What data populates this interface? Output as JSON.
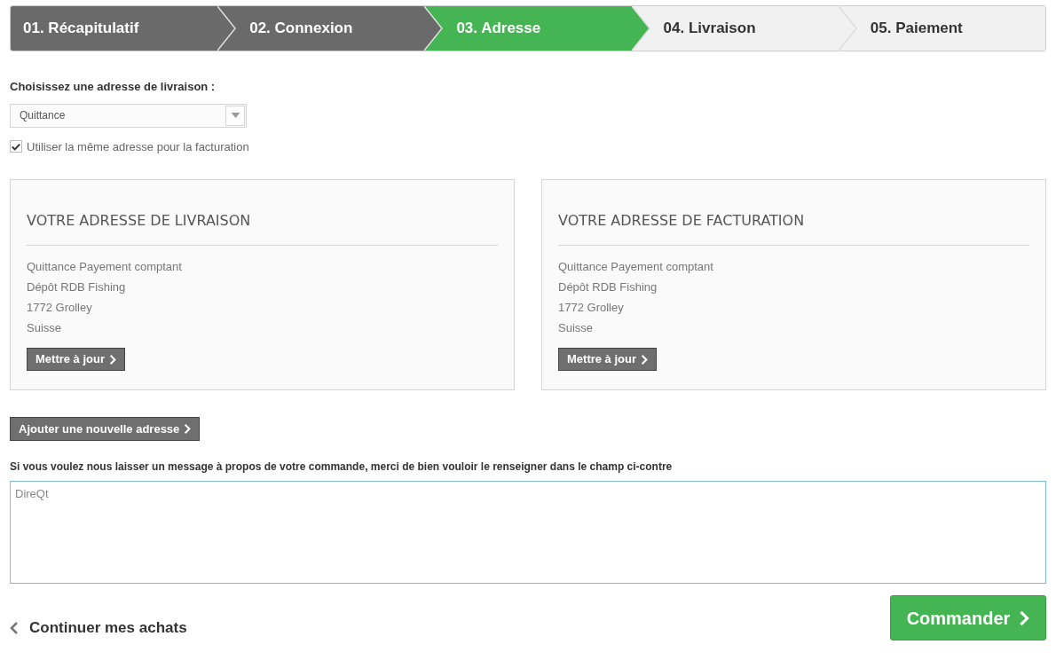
{
  "steps": [
    {
      "label": "01. Récapitulatif",
      "selected": false
    },
    {
      "label": "02. Connexion",
      "selected": false
    },
    {
      "label": "03. Adresse",
      "selected": true
    },
    {
      "label": "04. Livraison",
      "selected": false
    },
    {
      "label": "05. Paiement",
      "selected": false
    }
  ],
  "address_select": {
    "label": "Choisissez une adresse de livraison :",
    "value": "Quittance"
  },
  "same_billing": {
    "label": "Utiliser la même adresse pour la facturation",
    "checked": true
  },
  "address_cards": [
    {
      "title": "VOTRE ADRESSE DE LIVRAISON",
      "lines": [
        "Quittance Payement comptant",
        "Dépôt RDB Fishing",
        "1772 Grolley",
        "Suisse"
      ],
      "button": "Mettre à jour"
    },
    {
      "title": "VOTRE ADRESSE DE FACTURATION",
      "lines": [
        "Quittance Payement comptant",
        "Dépôt RDB Fishing",
        "1772 Grolley",
        "Suisse"
      ],
      "button": "Mettre à jour"
    }
  ],
  "add_address_button": "Ajouter une nouvelle adresse",
  "message": {
    "label": "Si vous voulez nous laisser un message à propos de votre commande, merci de bien vouloir le renseigner dans le champ ci-contre",
    "value": "DireQt"
  },
  "continue_link": "Continuer mes achats",
  "order_button": "Commander"
}
